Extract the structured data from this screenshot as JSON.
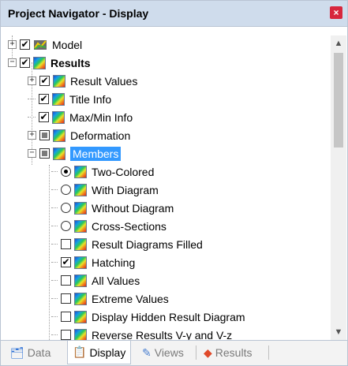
{
  "title": "Project Navigator - Display",
  "tree": [
    {
      "label": "Model",
      "state": "checked",
      "icon": "model-icon"
    },
    {
      "label": "Results",
      "state": "checked",
      "icon": "results-icon"
    },
    {
      "label": "Result Values",
      "state": "checked",
      "icon": "results-icon"
    },
    {
      "label": "Title Info",
      "state": "checked",
      "icon": "results-icon"
    },
    {
      "label": "Max/Min Info",
      "state": "checked",
      "icon": "results-icon"
    },
    {
      "label": "Deformation",
      "state": "partial",
      "icon": "results-icon"
    },
    {
      "label": "Members",
      "state": "partial",
      "icon": "results-icon"
    },
    {
      "label": "Two-Colored",
      "state": "radio-on",
      "icon": "results-icon"
    },
    {
      "label": "With Diagram",
      "state": "radio-off",
      "icon": "results-icon"
    },
    {
      "label": "Without Diagram",
      "state": "radio-off",
      "icon": "results-icon"
    },
    {
      "label": "Cross-Sections",
      "state": "radio-off",
      "icon": "results-icon"
    },
    {
      "label": "Result Diagrams Filled",
      "state": "unchecked",
      "icon": "results-icon"
    },
    {
      "label": "Hatching",
      "state": "checked",
      "icon": "results-icon"
    },
    {
      "label": "All Values",
      "state": "unchecked",
      "icon": "results-icon"
    },
    {
      "label": "Extreme Values",
      "state": "unchecked",
      "icon": "results-icon"
    },
    {
      "label": "Display Hidden Result Diagram",
      "state": "unchecked",
      "icon": "results-icon"
    },
    {
      "label": "Reverse Results V-y and V-z",
      "state": "unchecked",
      "icon": "results-icon"
    }
  ],
  "tabs": [
    {
      "label": "Data",
      "icon": "data-icon"
    },
    {
      "label": "Display",
      "icon": "display-icon"
    },
    {
      "label": "Views",
      "icon": "views-icon"
    },
    {
      "label": "Results",
      "icon": "results-tab-icon"
    }
  ],
  "scrollbar": {
    "position": 0.0
  },
  "colors": {
    "titlebar": "#cfdcec",
    "selection": "#3399ff",
    "close": "#d7263d"
  }
}
